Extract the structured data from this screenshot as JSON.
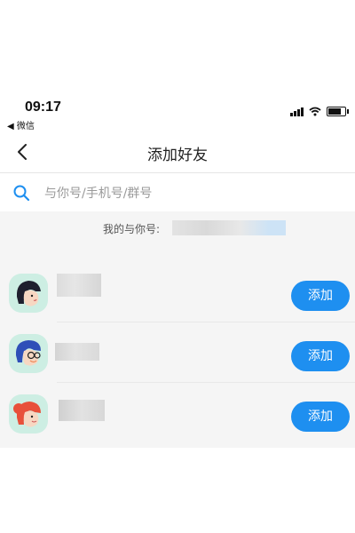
{
  "status_bar": {
    "time": "09:17",
    "back_app": "◀ 微信"
  },
  "nav": {
    "title": "添加好友"
  },
  "search": {
    "placeholder": "与你号/手机号/群号"
  },
  "my_id": {
    "label": "我的与你号:"
  },
  "contacts": [
    {
      "add_label": "添加"
    },
    {
      "add_label": "添加"
    },
    {
      "add_label": "添加"
    }
  ],
  "colors": {
    "accent": "#1e8ff0",
    "avatar_bg": "#cdeee3"
  }
}
